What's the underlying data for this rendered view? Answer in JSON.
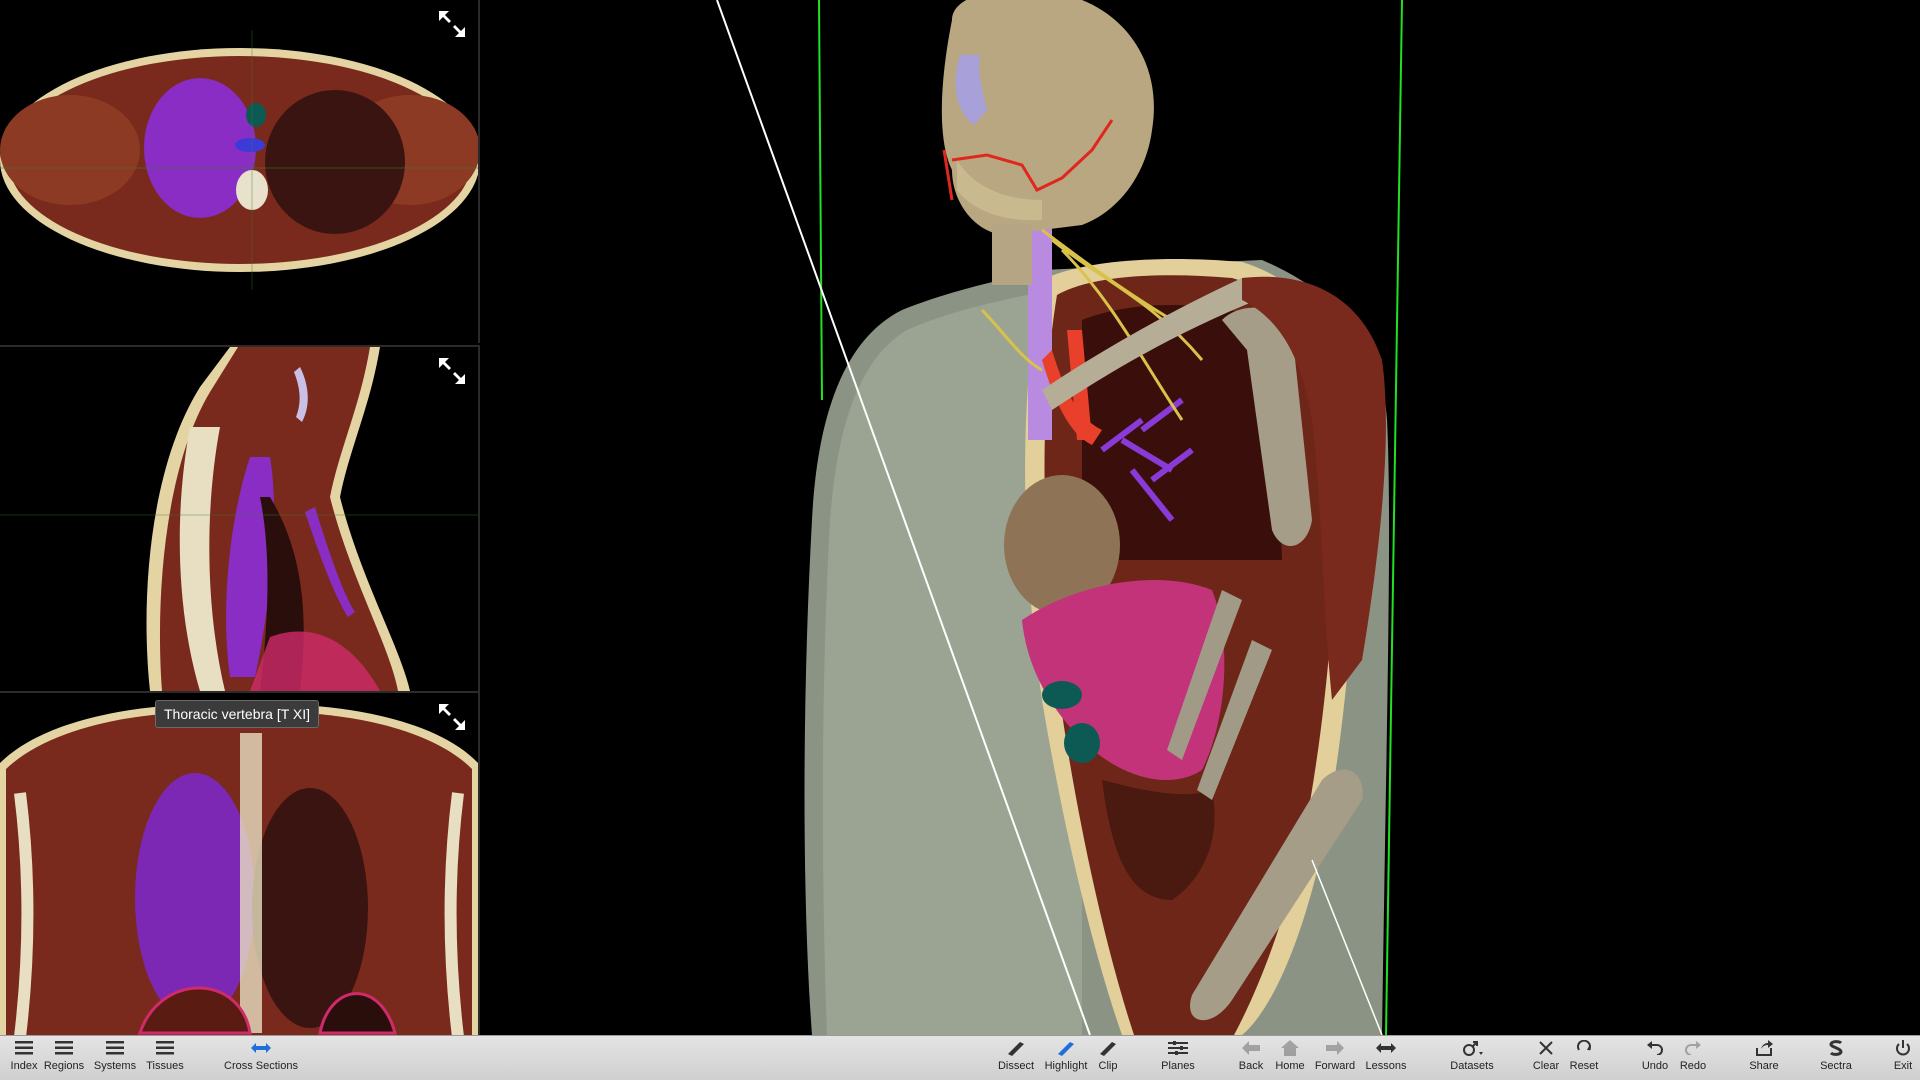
{
  "tooltip": {
    "text": "Thoracic vertebra [T XI]"
  },
  "panels": {
    "axial": {
      "expand_icon": "expand-arrows-icon"
    },
    "sagittal": {
      "expand_icon": "expand-arrows-icon"
    },
    "coronal": {
      "expand_icon": "expand-arrows-icon"
    }
  },
  "toolbar": {
    "index": "Index",
    "regions": "Regions",
    "systems": "Systems",
    "tissues": "Tissues",
    "cross_sections": "Cross Sections",
    "dissect": "Dissect",
    "highlight": "Highlight",
    "clip": "Clip",
    "planes": "Planes",
    "back": "Back",
    "home": "Home",
    "forward": "Forward",
    "lessons": "Lessons",
    "datasets": "Datasets",
    "clear": "Clear",
    "reset": "Reset",
    "undo": "Undo",
    "redo": "Redo",
    "share": "Share",
    "sectra": "Sectra",
    "exit": "Exit"
  },
  "colors": {
    "accent_blue": "#1e6fd9",
    "clip_plane_green": "#22e022",
    "toolbar_bg": "#d8d8d8"
  }
}
